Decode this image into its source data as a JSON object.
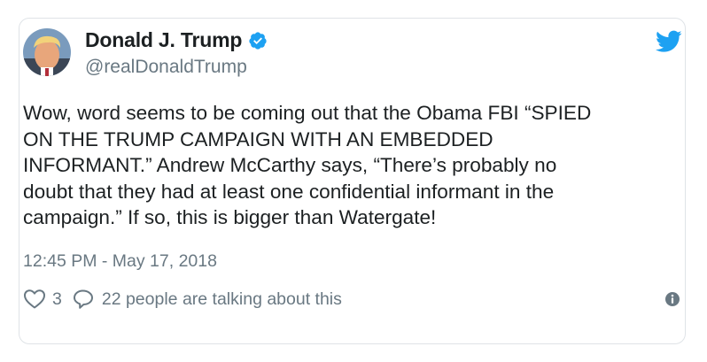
{
  "author": {
    "display_name": "Donald J. Trump",
    "handle": "@realDonaldTrump",
    "verified": true,
    "avatar_icon": "profile-photo"
  },
  "tweet": {
    "text": "Wow, word seems to be coming out that the Obama FBI “SPIED\nON THE TRUMP CAMPAIGN WITH AN EMBEDDED\nINFORMANT.” Andrew McCarthy says, “There’s probably no\ndoubt that they had at least one confidential informant in the\ncampaign.” If so, this is bigger than Watergate!",
    "timestamp": "12:45 PM - May 17, 2018"
  },
  "actions": {
    "like_count": "3",
    "conversation_label": "22 people are talking about this"
  },
  "icons": {
    "brand": "twitter-bird-icon",
    "verified": "verified-badge-icon",
    "like": "heart-icon",
    "reply": "speech-bubble-icon",
    "info": "info-icon"
  },
  "colors": {
    "twitter_blue": "#1da1f2",
    "text_primary": "#1c2022",
    "text_secondary": "#697882",
    "border": "#dfe3e7"
  }
}
